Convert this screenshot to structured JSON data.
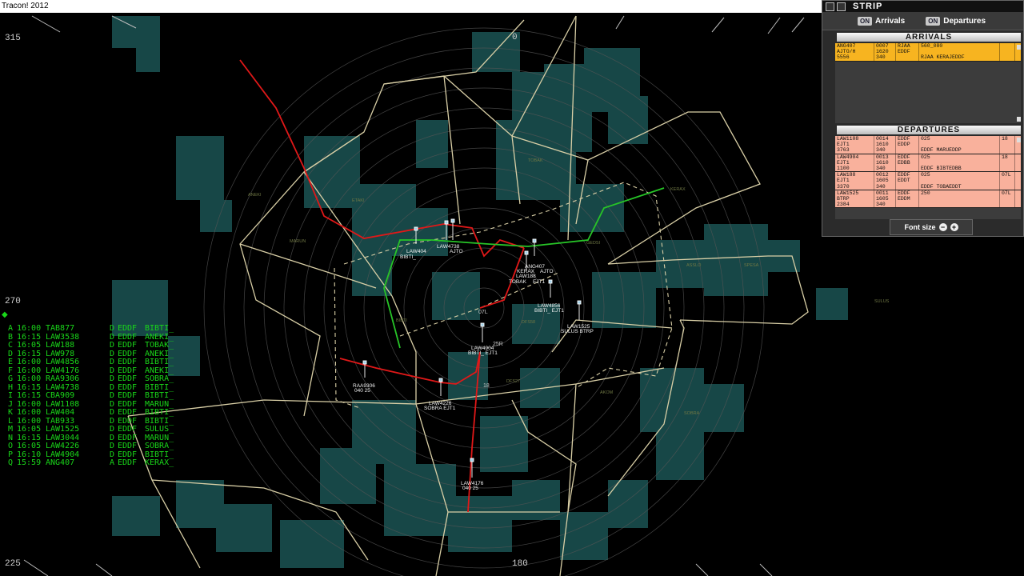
{
  "window": {
    "title": "Tracon! 2012"
  },
  "bearings": [
    {
      "label": "315",
      "pos": "left-top"
    },
    {
      "label": "0",
      "pos": "top"
    },
    {
      "label": "270",
      "pos": "left-mid"
    },
    {
      "label": "225",
      "pos": "left-bottom"
    },
    {
      "label": "180",
      "pos": "bottom"
    }
  ],
  "flight_list": [
    {
      "letter": "A",
      "time": "16:00",
      "callsign": "TAB877",
      "type": "D",
      "airport": "EDDF",
      "fix": "BIBTI_"
    },
    {
      "letter": "B",
      "time": "16:15",
      "callsign": "LAW3538",
      "type": "D",
      "airport": "EDDF",
      "fix": "ANEKI_"
    },
    {
      "letter": "C",
      "time": "16:05",
      "callsign": "LAW188",
      "type": "D",
      "airport": "EDDF",
      "fix": "TOBAK_"
    },
    {
      "letter": "D",
      "time": "16:15",
      "callsign": "LAW978",
      "type": "D",
      "airport": "EDDF",
      "fix": "ANEKI_"
    },
    {
      "letter": "E",
      "time": "16:00",
      "callsign": "LAW4856",
      "type": "D",
      "airport": "EDDF",
      "fix": "BIBTI_"
    },
    {
      "letter": "F",
      "time": "16:00",
      "callsign": "LAW4176",
      "type": "D",
      "airport": "EDDF",
      "fix": "ANEKI_"
    },
    {
      "letter": "G",
      "time": "16:00",
      "callsign": "RAA9306",
      "type": "D",
      "airport": "EDDF",
      "fix": "SOBRA_"
    },
    {
      "letter": "H",
      "time": "16:15",
      "callsign": "LAW4738",
      "type": "D",
      "airport": "EDDF",
      "fix": "BIBTI_"
    },
    {
      "letter": "I",
      "time": "16:15",
      "callsign": "CBA909",
      "type": "D",
      "airport": "EDDF",
      "fix": "BIBTI_"
    },
    {
      "letter": "J",
      "time": "16:00",
      "callsign": "LAW1108",
      "type": "D",
      "airport": "EDDF",
      "fix": "MARUN_"
    },
    {
      "letter": "K",
      "time": "16:00",
      "callsign": "LAW404",
      "type": "D",
      "airport": "EDDF",
      "fix": "BIBTI_"
    },
    {
      "letter": "L",
      "time": "16:00",
      "callsign": "TAB933",
      "type": "D",
      "airport": "EDDF",
      "fix": "BIBTI_"
    },
    {
      "letter": "M",
      "time": "16:05",
      "callsign": "LAW1525",
      "type": "D",
      "airport": "EDDF",
      "fix": "SULUS_"
    },
    {
      "letter": "N",
      "time": "16:15",
      "callsign": "LAW3044",
      "type": "D",
      "airport": "EDDF",
      "fix": "MARUN_"
    },
    {
      "letter": "O",
      "time": "16:05",
      "callsign": "LAW4226",
      "type": "D",
      "airport": "EDDF",
      "fix": "SOBRA_"
    },
    {
      "letter": "P",
      "time": "16:10",
      "callsign": "LAW4904",
      "type": "D",
      "airport": "EDDF",
      "fix": "BIBTI_"
    },
    {
      "letter": "Q",
      "time": "15:59",
      "callsign": "ANG407",
      "type": "A",
      "airport": "EDDF",
      "fix": "KERAX_"
    }
  ],
  "strip_panel": {
    "title": "STRIP",
    "toggles": [
      {
        "badge": "ON",
        "label": "Arrivals"
      },
      {
        "badge": "ON",
        "label": "Departures"
      }
    ],
    "arrivals_header": "ARRIVALS",
    "departures_header": "DEPARTURES",
    "arrivals": [
      {
        "c1": [
          "ANG407",
          "AJTO/H",
          "5556"
        ],
        "c2": [
          "0007",
          "1620",
          "340"
        ],
        "c3": [
          "RJAA",
          "EDDF",
          ""
        ],
        "c4": [
          "560_080",
          "",
          "RJAA KERAJEDDF"
        ],
        "c5": [
          "",
          "",
          ""
        ]
      }
    ],
    "departures": [
      {
        "c1": [
          "LAW1108",
          "EJT1",
          "3763"
        ],
        "c2": [
          "0014",
          "1610",
          "340"
        ],
        "c3": [
          "EDDF",
          "EDDP",
          ""
        ],
        "c4": [
          "025",
          "",
          "EDDF MARUEDDP"
        ],
        "c5": [
          "18",
          "",
          ""
        ]
      },
      {
        "c1": [
          "LAW4904",
          "EJT1",
          "1100"
        ],
        "c2": [
          "0013",
          "1610",
          "340"
        ],
        "c3": [
          "EDDF",
          "EDBB",
          ""
        ],
        "c4": [
          "025",
          "",
          "EDDF BIBTEDBB"
        ],
        "c5": [
          "18",
          "",
          ""
        ]
      },
      {
        "c1": [
          "LAW188",
          "EJT1",
          "3370"
        ],
        "c2": [
          "0012",
          "1605",
          "340"
        ],
        "c3": [
          "EDDF",
          "EDDT",
          ""
        ],
        "c4": [
          "025",
          "",
          "EDDF TOBAEDDT"
        ],
        "c5": [
          "07L",
          "",
          ""
        ]
      },
      {
        "c1": [
          "LAW1525",
          "BTRP",
          "2384"
        ],
        "c2": [
          "0011",
          "1605",
          "340"
        ],
        "c3": [
          "EDDF",
          "EDDM",
          ""
        ],
        "c4": [
          "250",
          "",
          ""
        ],
        "c5": [
          "07L",
          "",
          ""
        ]
      }
    ],
    "font_size_label": "Font size",
    "minus": "−",
    "plus": "+"
  },
  "aircraft": [
    {
      "id": "law404",
      "line1": "LAW404",
      "line2": "BIBTI_"
    },
    {
      "id": "law4738",
      "line1": "LAW4738",
      "line2": "BIBTI_"
    },
    {
      "id": "tab933",
      "line1": "TAB933",
      "line2": "AJTO"
    },
    {
      "id": "ang407",
      "line1": "ANG407",
      "line2": "KERAX"
    },
    {
      "id": "law188",
      "line1": "LAW188",
      "line2": "TOBAK"
    },
    {
      "id": "ang407-b",
      "line1": "AJTO",
      "line2": "EJT1"
    },
    {
      "id": "law4856",
      "line1": "LAW4856",
      "line2": "BIBTI_ EJT1"
    },
    {
      "id": "law1525",
      "line1": "LAW1525",
      "line2": "SULUS BTRP"
    },
    {
      "id": "law4904",
      "line1": "LAW4904",
      "line2": "BIBTI_ EJT1"
    },
    {
      "id": "raa9306",
      "line1": "RAA9306",
      "line2": "040 25"
    },
    {
      "id": "law4226",
      "line1": "LAW4226",
      "line2": "SOBRA EJT1"
    },
    {
      "id": "law4176",
      "line1": "LAW4176",
      "line2": "040 25"
    }
  ],
  "waypoints": [
    "TOBAK",
    "KERAX",
    "ANEKI",
    "GEDSI",
    "SULUS",
    "MARUN",
    "BIBTI",
    "SOBRA",
    "ASSLO",
    "DFS58",
    "AKOM",
    "DFS27",
    "SPESA",
    "ETAKI"
  ],
  "runway_labels": [
    "07L",
    "25R",
    "18"
  ],
  "colors": {
    "sector_lines": "#d9cfa6",
    "arrival_route": "#e01818",
    "departure_route": "#27c427",
    "weather": "#1f5f5f",
    "flight_list_text": "#19d619",
    "arrival_strip": "#f7b420",
    "departure_strip": "#f9b19c"
  }
}
